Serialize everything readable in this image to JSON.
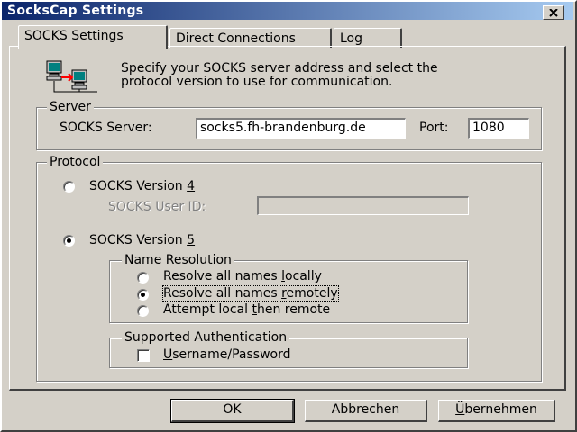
{
  "window": {
    "title": "SocksCap Settings"
  },
  "tabs": [
    {
      "label": "SOCKS Settings",
      "active": true
    },
    {
      "label": "Direct Connections",
      "active": false
    },
    {
      "label": "Log",
      "active": false
    }
  ],
  "intro": {
    "icon": "network-computers-icon",
    "line1": "Specify your SOCKS server address and select the",
    "line2": "protocol version to use for communication."
  },
  "server": {
    "legend": "Server",
    "server_label": "SOCKS Server:",
    "server_value": "socks5.fh-brandenburg.de",
    "port_label": "Port:",
    "port_value": "1080"
  },
  "protocol": {
    "legend": "Protocol",
    "v4_label_prefix": "SOCKS Version ",
    "v4_label_accel": "4",
    "v4_selected": false,
    "user_id_label": "SOCKS User ID:",
    "user_id_value": "",
    "v5_label_prefix": "SOCKS Version ",
    "v5_label_accel": "5",
    "v5_selected": true,
    "name_resolution": {
      "legend": "Name Resolution",
      "options": [
        {
          "pre": "Resolve all names ",
          "accel": "l",
          "post": "ocally",
          "selected": false
        },
        {
          "pre": "Resolve all names ",
          "accel": "r",
          "post": "emotely",
          "selected": true
        },
        {
          "pre": "Attempt local ",
          "accel": "t",
          "post": "hen remote",
          "selected": false
        }
      ]
    },
    "auth": {
      "legend": "Supported Authentication",
      "checkbox_accel": "U",
      "checkbox_rest": "sername/Password",
      "checked": false
    }
  },
  "buttons": {
    "ok": "OK",
    "cancel": "Abbrechen",
    "apply_accel": "Ü",
    "apply_rest": "bernehmen"
  }
}
